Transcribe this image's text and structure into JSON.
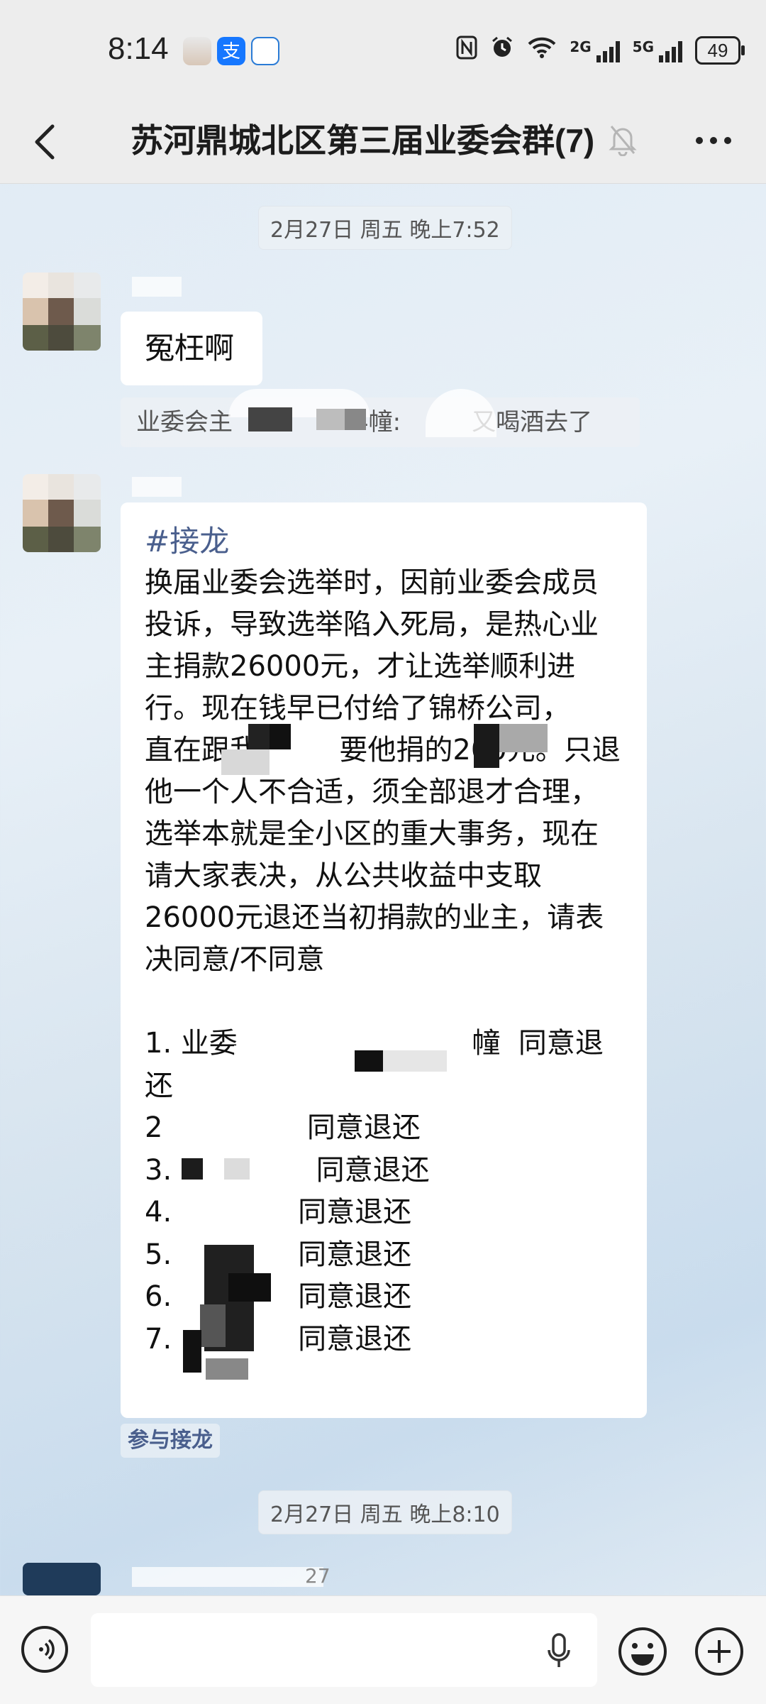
{
  "status_bar": {
    "time": "8:14",
    "battery": "49",
    "signal_labels": [
      "2G",
      "5G"
    ]
  },
  "header": {
    "title": "苏河鼎城北区第三届业委会群(7)"
  },
  "messages": {
    "timestamp_1": "2月27日 周五 晚上7:52",
    "short_message": "冤枉啊",
    "quote_prefix": "业委会主",
    "quote_mid": "4幢:",
    "quote_suffix": "又喝酒去了",
    "tag": "#接龙",
    "body": "换届业委会选举时，因前业委会成员投诉，导致选举陷入死局，是热心业主捐款26000元，才让选举顺利进行。现在钱早已付给了锦桥公司，        直在跟我         要他捐的200元。只退他一个人不合适，须全部退才合理，选举本就是全小区的重大事务，现在请大家表决，从公共收益中支取26000元退还当初捐款的业主，请表决同意/不同意",
    "list": [
      "1. 业委                          幢  同意退还",
      "2                同意退还",
      "3.                同意退还",
      "4.              同意退还",
      "5.              同意退还",
      "6.              同意退还",
      "7.              同意退还"
    ],
    "join_button": "参与接龙",
    "timestamp_2": "2月27日 周五 晚上8:10",
    "partial_name": "27"
  },
  "colors": {
    "tag_blue": "#4a5f8d",
    "bubble_white": "#ffffff",
    "bar_gray": "#ededed"
  },
  "icons": [
    "back-icon",
    "mute-bell-icon",
    "more-icon",
    "voice-icon",
    "mic-icon",
    "emoji-icon",
    "plus-icon"
  ]
}
